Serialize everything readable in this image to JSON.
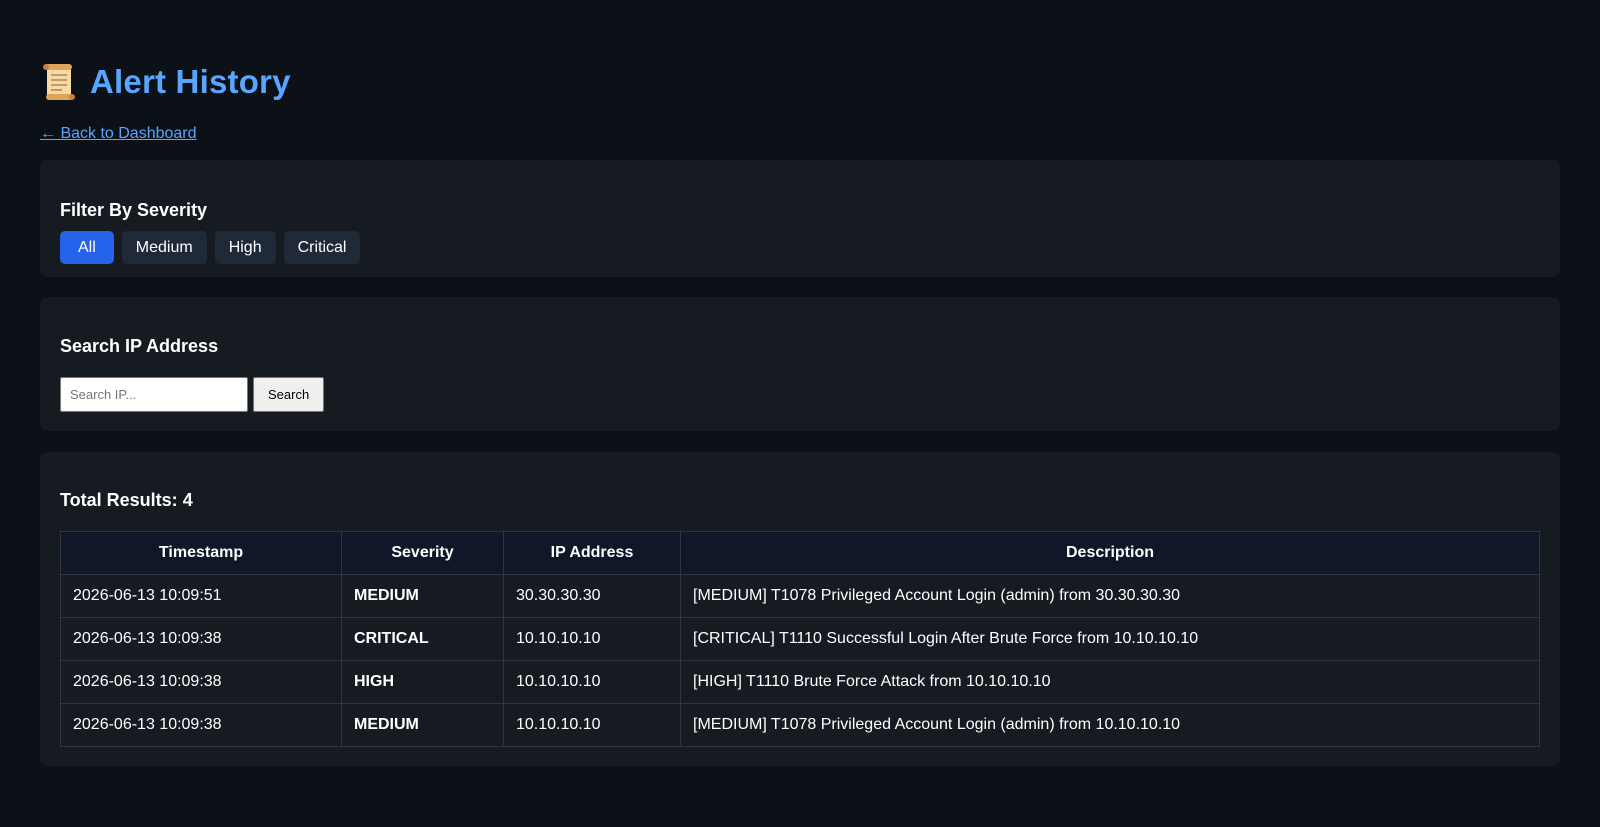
{
  "header": {
    "title": "Alert History",
    "back_link": "← Back to Dashboard"
  },
  "filter": {
    "heading": "Filter By Severity",
    "buttons": [
      "All",
      "Medium",
      "High",
      "Critical"
    ],
    "active": "All"
  },
  "search": {
    "heading": "Search IP Address",
    "placeholder": "Search IP...",
    "value": "",
    "button_label": "Search"
  },
  "results": {
    "total_label": "Total Results:",
    "total": "4",
    "columns": [
      "Timestamp",
      "Severity",
      "IP Address",
      "Description"
    ],
    "rows": [
      {
        "timestamp": "2026-06-13 10:09:51",
        "severity": "MEDIUM",
        "ip": "30.30.30.30",
        "description": "[MEDIUM] T1078 Privileged Account Login (admin) from 30.30.30.30"
      },
      {
        "timestamp": "2026-06-13 10:09:38",
        "severity": "CRITICAL",
        "ip": "10.10.10.10",
        "description": "[CRITICAL] T1110 Successful Login After Brute Force from 10.10.10.10"
      },
      {
        "timestamp": "2026-06-13 10:09:38",
        "severity": "HIGH",
        "ip": "10.10.10.10",
        "description": "[HIGH] T1110 Brute Force Attack from 10.10.10.10"
      },
      {
        "timestamp": "2026-06-13 10:09:38",
        "severity": "MEDIUM",
        "ip": "10.10.10.10",
        "description": "[MEDIUM] T1078 Privileged Account Login (admin) from 10.10.10.10"
      }
    ]
  },
  "colors": {
    "background": "#0c1017",
    "card": "#161b22",
    "accent": "#58a6ff",
    "active_button": "#2563eb",
    "medium": "#58a6ff",
    "high": "#f0a30a",
    "critical": "#f85149"
  },
  "icons": {
    "title_icon": "scroll-icon"
  }
}
